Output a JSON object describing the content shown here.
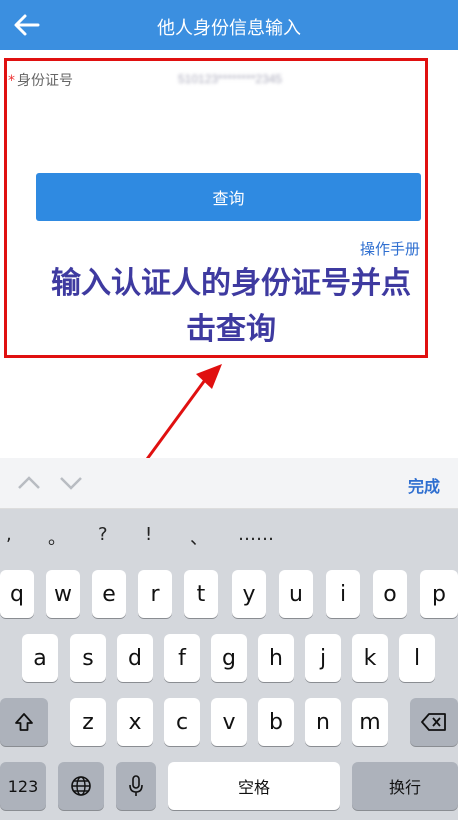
{
  "header": {
    "title": "他人身份信息输入"
  },
  "form": {
    "id_label_required": "*",
    "id_label": "身份证号",
    "id_value": "510123********2345",
    "query_button": "查询",
    "manual_link": "操作手册"
  },
  "annotation": {
    "text_line1": "输入认证人的身份证号并点",
    "text_line2": "击查询"
  },
  "keyboard": {
    "done": "完成",
    "punctuation": [
      ",",
      "。",
      "?",
      "!",
      "、",
      "……"
    ],
    "row1": [
      "q",
      "w",
      "e",
      "r",
      "t",
      "y",
      "u",
      "i",
      "o",
      "p"
    ],
    "row2": [
      "a",
      "s",
      "d",
      "f",
      "g",
      "h",
      "j",
      "k",
      "l"
    ],
    "row3": [
      "z",
      "x",
      "c",
      "v",
      "b",
      "n",
      "m"
    ],
    "num_key": "123",
    "space_key": "空格",
    "return_key": "换行"
  },
  "colors": {
    "header": "#3b8fe0",
    "button": "#2f8ae1",
    "annotation_red": "#e01010",
    "annotation_text": "#3e3aa0"
  }
}
